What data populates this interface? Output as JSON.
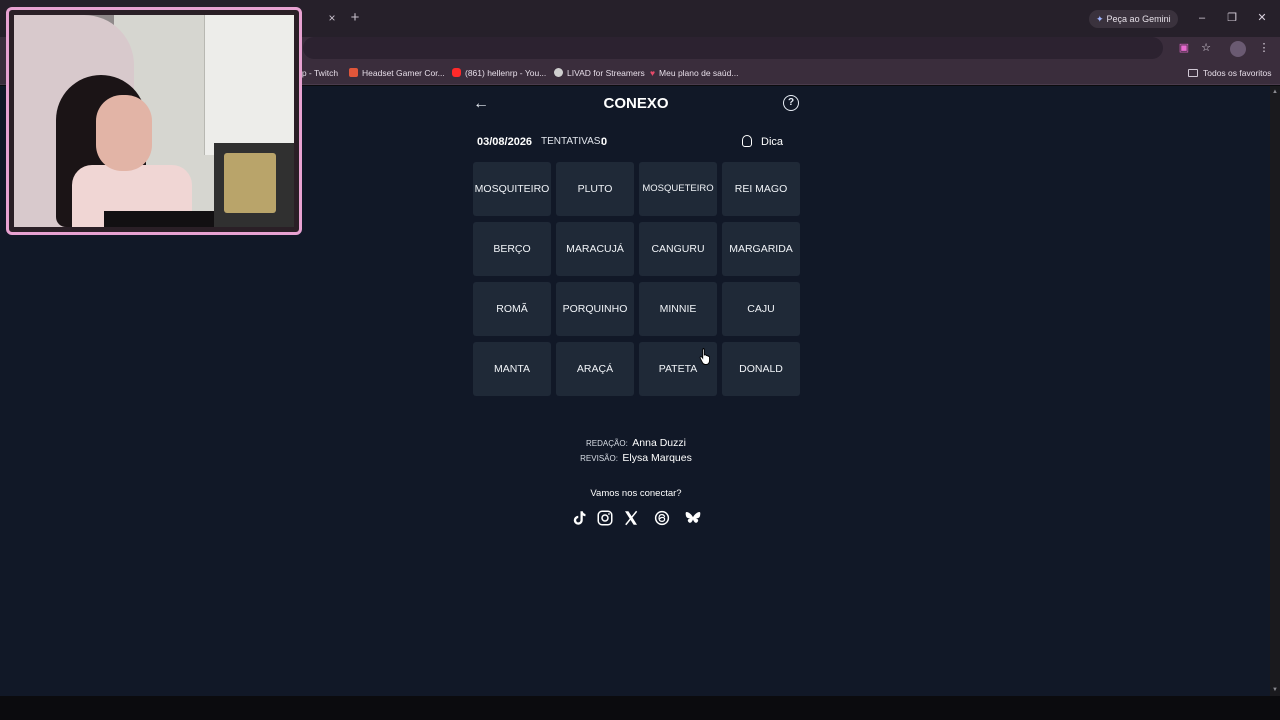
{
  "browser": {
    "tab_close": "×",
    "new_tab": "+",
    "gemini_label": "Peça ao Gemini",
    "window": {
      "minimize": "–",
      "maximize": "❐",
      "close": "✕"
    },
    "bookmarks": [
      {
        "label": "rp - Twitch",
        "color": "#9146ff"
      },
      {
        "label": "Headset Gamer Cor...",
        "color": "#e0563a"
      },
      {
        "label": "(861) hellenrp - You...",
        "color": "#ff2a2a"
      },
      {
        "label": "LIVAD for Streamers",
        "color": "#cfcfcf"
      },
      {
        "label": "Meu plano de saúd...",
        "color": "#e84a6a"
      }
    ],
    "bookmarks_folder": "Todos os favoritos"
  },
  "game": {
    "back": "←",
    "title": "CONEXO",
    "help": "?",
    "date": "03/08/2026",
    "tries_label": "TENTATIVAS:",
    "tries_value": "0",
    "hint_label": "Dica",
    "tiles": [
      "MOSQUITEIRO",
      "PLUTO",
      "MOSQUETEIRO",
      "REI MAGO",
      "BERÇO",
      "MARACUJÁ",
      "CANGURU",
      "MARGARIDA",
      "ROMÃ",
      "PORQUINHO",
      "MINNIE",
      "CAJU",
      "MANTA",
      "ARAÇÁ",
      "PATETA",
      "DONALD"
    ]
  },
  "credits": {
    "editor_label": "REDAÇÃO:",
    "editor_name": "Anna Duzzi",
    "reviewer_label": "REVISÃO:",
    "reviewer_name": "Elysa Marques"
  },
  "social": {
    "title": "Vamos nos conectar?",
    "icons": [
      "tiktok-icon",
      "instagram-icon",
      "x-icon",
      "threads-icon",
      "bluesky-icon"
    ]
  }
}
